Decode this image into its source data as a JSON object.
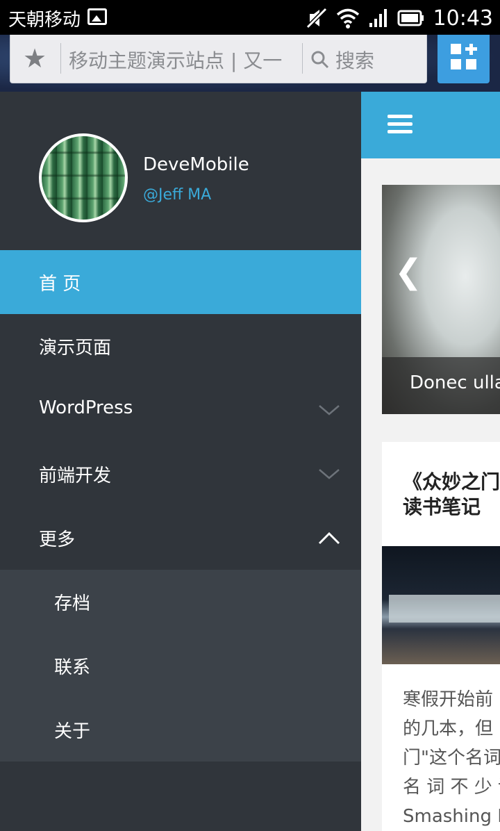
{
  "status_bar": {
    "carrier": "天朝移动",
    "time": "10:43",
    "icons": [
      "image-icon",
      "mute-icon",
      "wifi-icon",
      "signal-icon",
      "battery-icon"
    ]
  },
  "browser": {
    "url": "移动主题演示站点 | 又一",
    "search_label": "搜索"
  },
  "drawer": {
    "username": "DeveMobile",
    "handle": "@Jeff MA",
    "menu": [
      {
        "label": "首 页",
        "active": true
      },
      {
        "label": "演示页面"
      },
      {
        "label": "WordPress",
        "expandable": true
      },
      {
        "label": "前端开发",
        "expandable": true
      },
      {
        "label": "更多",
        "expanded": true
      }
    ],
    "submenu": [
      {
        "label": "存档"
      },
      {
        "label": "联系"
      },
      {
        "label": "关于"
      }
    ]
  },
  "content": {
    "slider_caption": "Donec ulla",
    "post_title_line1": "《众妙之门",
    "post_title_line2": "读书笔记",
    "excerpt_lines": [
      "寒假开始前",
      "的几本，但",
      "门\"这个名词",
      "名 词 不 少 诉",
      "Smashing M"
    ]
  },
  "colors": {
    "accent": "#3aaad9",
    "drawer_bg": "#30353b",
    "submenu_bg": "#3c4249",
    "apps_button": "#3d9ee0"
  }
}
